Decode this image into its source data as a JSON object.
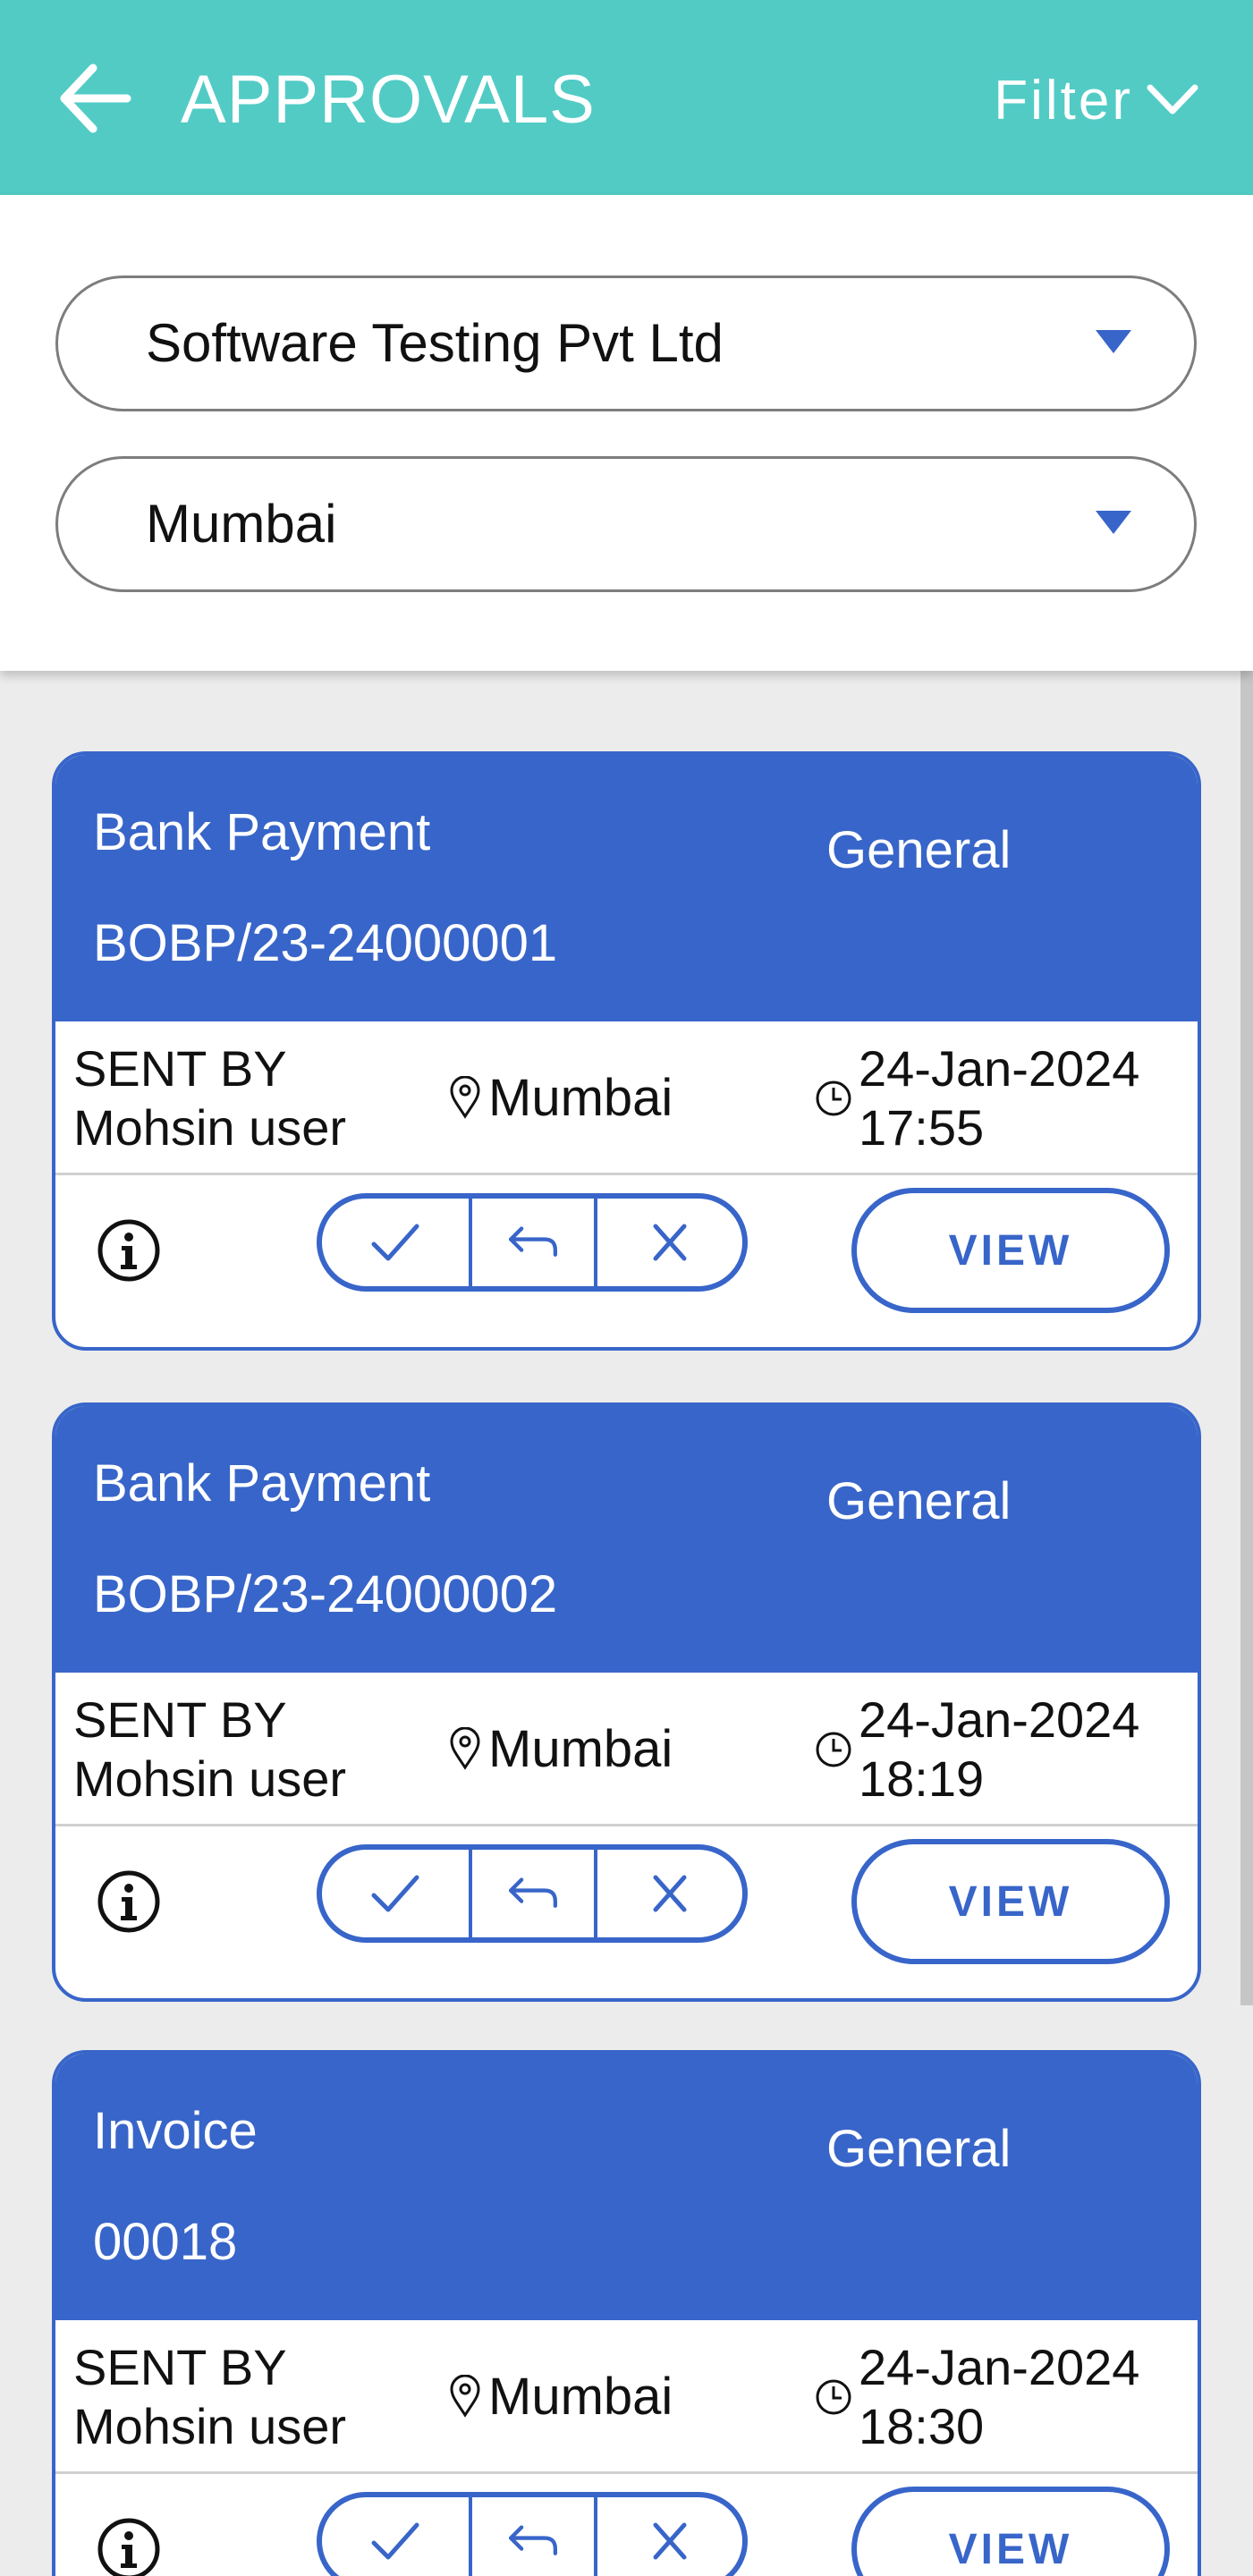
{
  "header": {
    "title": "APPROVALS",
    "filter_label": "Filter"
  },
  "filters": {
    "company": "Software Testing Pvt Ltd",
    "location": "Mumbai"
  },
  "cards": [
    {
      "doc_type": "Bank Payment",
      "doc_no": "BOBP/23-24000001",
      "category": "General",
      "sent_by_label": "SENT BY",
      "sent_by_user": "Mohsin user",
      "location": "Mumbai",
      "date": "24-Jan-2024",
      "time": "17:55",
      "view_label": "VIEW"
    },
    {
      "doc_type": "Bank Payment",
      "doc_no": "BOBP/23-24000002",
      "category": "General",
      "sent_by_label": "SENT BY",
      "sent_by_user": "Mohsin user",
      "location": "Mumbai",
      "date": "24-Jan-2024",
      "time": "18:19",
      "view_label": "VIEW"
    },
    {
      "doc_type": "Invoice",
      "doc_no": "00018",
      "category": "General",
      "sent_by_label": "SENT BY",
      "sent_by_user": "Mohsin user",
      "location": "Mumbai",
      "date": "24-Jan-2024",
      "time": "18:30",
      "view_label": "VIEW"
    }
  ],
  "icons": {
    "back": "arrow-left-icon",
    "filter": "chevron-down-icon",
    "dropdown": "caret-down-icon",
    "location": "map-pin-icon",
    "time": "clock-icon",
    "info": "info-circle-icon",
    "approve": "check-icon",
    "return": "reply-icon",
    "reject": "close-icon"
  },
  "colors": {
    "header_bg": "#52cbc5",
    "card_accent": "#3865c9",
    "page_bg": "#ececec"
  }
}
